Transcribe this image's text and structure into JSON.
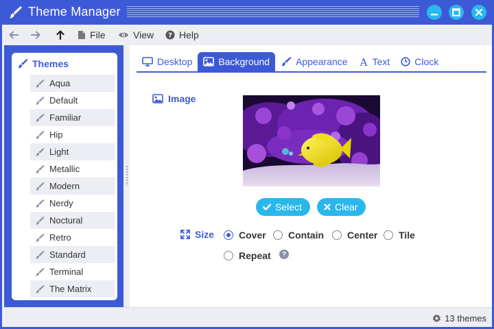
{
  "window": {
    "title": "Theme Manager"
  },
  "colors": {
    "accent": "#3d5ad6",
    "button": "#2ab7ec",
    "row_alt": "#eceef4"
  },
  "titlebar_buttons": [
    "minimize-icon",
    "maximize-icon",
    "close-icon"
  ],
  "menubar": {
    "nav": [
      "back-arrow-icon",
      "forward-arrow-icon",
      "up-arrow-icon"
    ],
    "file_label": "File",
    "view_label": "View",
    "help_label": "Help"
  },
  "sidebar": {
    "heading": "Themes",
    "themes": [
      "Aqua",
      "Default",
      "Familiar",
      "Hip",
      "Light",
      "Metallic",
      "Modern",
      "Nerdy",
      "Noctural",
      "Retro",
      "Standard",
      "Terminal",
      "The Matrix"
    ]
  },
  "tabs": [
    {
      "label": "Desktop",
      "icon": "monitor-icon"
    },
    {
      "label": "Background",
      "icon": "image-icon",
      "active": true
    },
    {
      "label": "Appearance",
      "icon": "brush-icon"
    },
    {
      "label": "Text",
      "icon": "font-icon"
    },
    {
      "label": "Clock",
      "icon": "clock-icon"
    }
  ],
  "background": {
    "image_label": "Image",
    "select_label": "Select",
    "clear_label": "Clear",
    "size_label": "Size",
    "size_options": [
      "Cover",
      "Contain",
      "Center",
      "Tile",
      "Repeat"
    ],
    "size_selected": "Cover"
  },
  "status": {
    "count_text": "13 themes"
  }
}
